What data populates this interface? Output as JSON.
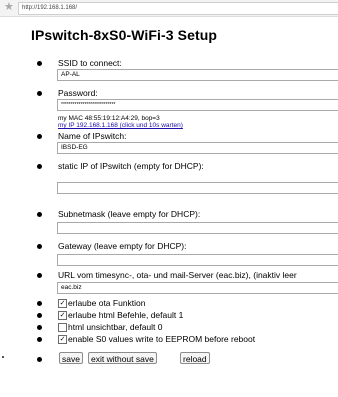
{
  "browser": {
    "url": "http://192.168.1.168/",
    "star": "★"
  },
  "page": {
    "title": "IPswitch-8xS0-WiFi-3 Setup"
  },
  "fields": {
    "ssid_label": "SSID to connect:",
    "ssid_value": "AP-AL",
    "password_label": "Password:",
    "password_value": "****************************",
    "mac_line": "my MAC 48:55:19:12:A4:29, bop=3",
    "ip_link": "my IP 192.168.1.168 (click und 10s warten)",
    "name_label": "Name of IPswitch:",
    "name_value": "IBSD-EG",
    "static_ip_label": "static IP of IPswitch (empty for DHCP):",
    "static_ip_value": "",
    "subnet_label": "Subnetmask (leave empty for DHCP):",
    "subnet_value": "",
    "gateway_label": "Gateway (leave empty for DHCP):",
    "gateway_value": "",
    "url_label": "URL vom timesync-, ota- und mail-Server (eac.biz), (inaktiv leer",
    "url_value": "eac.biz"
  },
  "checkboxes": [
    {
      "label": "erlaube ota Funktion",
      "checked": true
    },
    {
      "label": "erlaube html Befehle, default 1",
      "checked": true
    },
    {
      "label": "html unsichtbar, default 0",
      "checked": false
    },
    {
      "label": "enable S0 values write to EEPROM before reboot",
      "checked": true
    }
  ],
  "buttons": {
    "save": "save",
    "exit": "exit without save",
    "reload": "reload"
  }
}
